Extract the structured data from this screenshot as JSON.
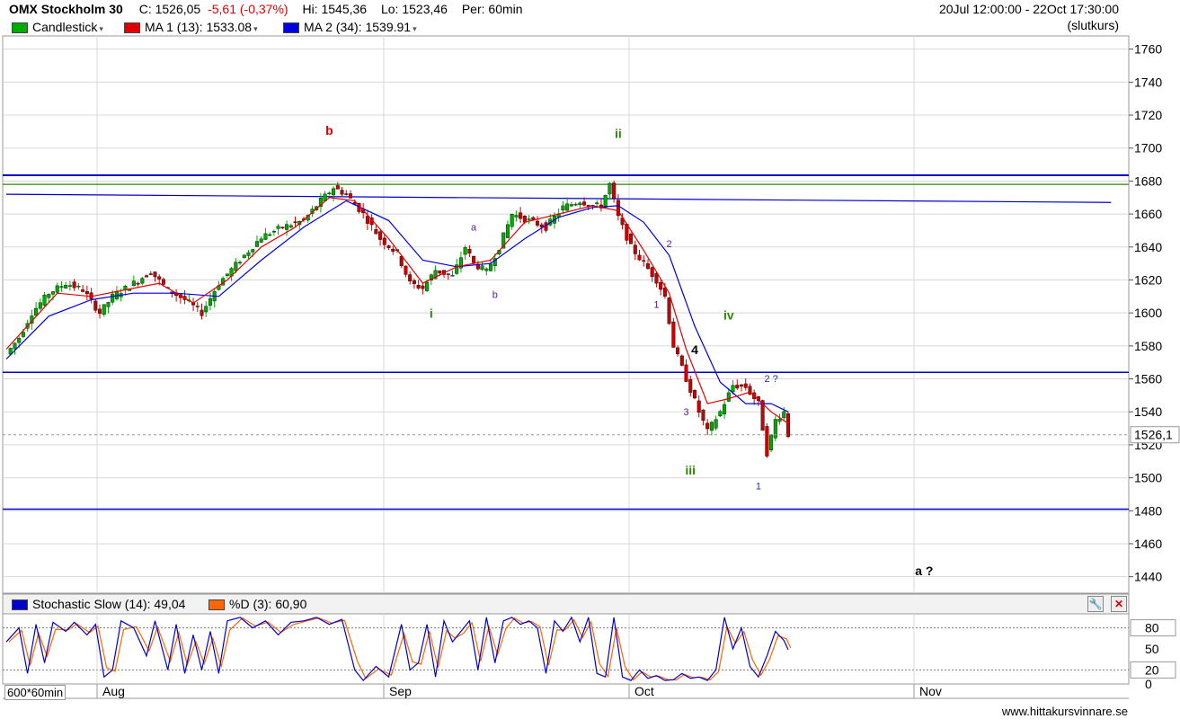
{
  "header": {
    "title": "OMX Stockholm 30",
    "close_label": "C:",
    "close_value": "1526,05",
    "change": "-5,61 (-0,37%)",
    "hi_label": "Hi:",
    "hi_value": "1545,36",
    "lo_label": "Lo:",
    "lo_value": "1523,46",
    "period_label": "Per:",
    "period_value": "60min",
    "date_range": "20Jul 12:00:00 - 22Oct 17:30:00",
    "price_note": "(slutkurs)"
  },
  "legend": {
    "candlestick": "Candlestick",
    "ma1": "MA 1 (13): 1533.08",
    "ma2": "MA 2 (34): 1539.91",
    "stoch": "Stochastic Slow (14): 49,04",
    "pctd": "%D (3): 60,90"
  },
  "colors": {
    "candle_swatch": "#00aa00",
    "ma1": "#e00000",
    "ma2": "#0000e0",
    "stoch": "#0000cc",
    "pctd": "#ff6600",
    "bull": "#00aa00",
    "bear": "#cc0000",
    "wave_red": "#dd0000",
    "wave_green": "#2a8a00",
    "wave_purple": "#551a8b",
    "wave_blue": "#2233aa"
  },
  "footer": {
    "interval_label": "600*60min",
    "website": "www.hittakursvinnare.se"
  },
  "chart_data": [
    {
      "type": "candlestick",
      "title": "OMX Stockholm 30",
      "x_tick_labels": [
        "Aug",
        "Sep",
        "Oct",
        "Nov"
      ],
      "y_ticks": [
        1440,
        1460,
        1480,
        1500,
        1520,
        1540,
        1560,
        1580,
        1600,
        1620,
        1640,
        1660,
        1680,
        1700,
        1720,
        1740,
        1760
      ],
      "ylim": [
        1430,
        1768
      ],
      "last_price_label": "1526,1",
      "last_price": 1526.1,
      "grid": true,
      "close_path": [
        [
          0,
          1575
        ],
        [
          3,
          1585
        ],
        [
          6,
          1600
        ],
        [
          10,
          1612
        ],
        [
          14,
          1618
        ],
        [
          18,
          1614
        ],
        [
          22,
          1600
        ],
        [
          25,
          1610
        ],
        [
          30,
          1618
        ],
        [
          34,
          1625
        ],
        [
          38,
          1614
        ],
        [
          42,
          1608
        ],
        [
          46,
          1600
        ],
        [
          50,
          1618
        ],
        [
          55,
          1632
        ],
        [
          60,
          1646
        ],
        [
          65,
          1652
        ],
        [
          70,
          1656
        ],
        [
          74,
          1668
        ],
        [
          77,
          1676
        ],
        [
          80,
          1672
        ],
        [
          84,
          1660
        ],
        [
          88,
          1645
        ],
        [
          92,
          1636
        ],
        [
          95,
          1618
        ],
        [
          98,
          1615
        ],
        [
          101,
          1626
        ],
        [
          105,
          1622
        ],
        [
          108,
          1640
        ],
        [
          110,
          1630
        ],
        [
          113,
          1625
        ],
        [
          116,
          1640
        ],
        [
          119,
          1660
        ],
        [
          123,
          1656
        ],
        [
          127,
          1652
        ],
        [
          131,
          1664
        ],
        [
          135,
          1668
        ],
        [
          138,
          1665
        ],
        [
          140,
          1665
        ],
        [
          142,
          1678
        ],
        [
          144,
          1658
        ],
        [
          147,
          1640
        ],
        [
          150,
          1630
        ],
        [
          153,
          1620
        ],
        [
          155,
          1610
        ],
        [
          157,
          1580
        ],
        [
          160,
          1560
        ],
        [
          163,
          1540
        ],
        [
          165,
          1528
        ],
        [
          168,
          1540
        ],
        [
          171,
          1556
        ],
        [
          174,
          1555
        ],
        [
          177,
          1545
        ],
        [
          179,
          1515
        ],
        [
          181,
          1535
        ],
        [
          183,
          1540
        ],
        [
          184,
          1526
        ]
      ],
      "ma1_path": [
        [
          0,
          1578
        ],
        [
          6,
          1595
        ],
        [
          12,
          1612
        ],
        [
          20,
          1610
        ],
        [
          28,
          1614
        ],
        [
          36,
          1618
        ],
        [
          44,
          1606
        ],
        [
          52,
          1620
        ],
        [
          60,
          1640
        ],
        [
          68,
          1652
        ],
        [
          76,
          1670
        ],
        [
          82,
          1668
        ],
        [
          90,
          1645
        ],
        [
          98,
          1618
        ],
        [
          106,
          1628
        ],
        [
          114,
          1632
        ],
        [
          122,
          1655
        ],
        [
          130,
          1660
        ],
        [
          138,
          1665
        ],
        [
          144,
          1662
        ],
        [
          150,
          1638
        ],
        [
          156,
          1612
        ],
        [
          160,
          1578
        ],
        [
          165,
          1545
        ],
        [
          170,
          1548
        ],
        [
          175,
          1552
        ],
        [
          180,
          1540
        ],
        [
          184,
          1533
        ]
      ],
      "ma2_path": [
        [
          0,
          1572
        ],
        [
          10,
          1598
        ],
        [
          20,
          1608
        ],
        [
          30,
          1612
        ],
        [
          40,
          1612
        ],
        [
          50,
          1610
        ],
        [
          60,
          1632
        ],
        [
          70,
          1652
        ],
        [
          80,
          1668
        ],
        [
          90,
          1656
        ],
        [
          98,
          1632
        ],
        [
          106,
          1628
        ],
        [
          114,
          1630
        ],
        [
          122,
          1645
        ],
        [
          130,
          1658
        ],
        [
          138,
          1664
        ],
        [
          144,
          1665
        ],
        [
          150,
          1655
        ],
        [
          156,
          1635
        ],
        [
          162,
          1592
        ],
        [
          168,
          1558
        ],
        [
          174,
          1545
        ],
        [
          180,
          1545
        ],
        [
          184,
          1540
        ]
      ],
      "horizontal_lines": [
        {
          "price": 1683.5,
          "color": "#0000cc",
          "width": 2
        },
        {
          "price": 1678,
          "color": "#2a8a00",
          "width": 1.2
        },
        {
          "price": 1564,
          "color": "#0000cc",
          "width": 1.5
        },
        {
          "price": 1481,
          "color": "#0000cc",
          "width": 1.5
        }
      ],
      "trendline": {
        "from": [
          0,
          1672
        ],
        "to": [
          260,
          1667
        ],
        "color": "#0000cc"
      },
      "wave_labels": [
        {
          "text": "b",
          "bar": 76,
          "price": 1708,
          "color": "red"
        },
        {
          "text": "ii",
          "bar": 144,
          "price": 1706,
          "color": "green"
        },
        {
          "text": "a",
          "bar": 110,
          "price": 1650,
          "color": "purple"
        },
        {
          "text": "b",
          "bar": 115,
          "price": 1609,
          "color": "purple"
        },
        {
          "text": "i",
          "bar": 100,
          "price": 1597,
          "color": "green"
        },
        {
          "text": "2",
          "bar": 156,
          "price": 1640,
          "color": "purple"
        },
        {
          "text": "1",
          "bar": 153,
          "price": 1603,
          "color": "purple"
        },
        {
          "text": "iv",
          "bar": 170,
          "price": 1596,
          "color": "green"
        },
        {
          "text": "4",
          "bar": 162,
          "price": 1575,
          "color": "black"
        },
        {
          "text": "3",
          "bar": 160,
          "price": 1538,
          "color": "purple"
        },
        {
          "text": "2 ?",
          "bar": 180,
          "price": 1558,
          "color": "blue"
        },
        {
          "text": "iii",
          "bar": 161,
          "price": 1502,
          "color": "green"
        },
        {
          "text": "1",
          "bar": 177,
          "price": 1493,
          "color": "blue"
        },
        {
          "text": "a ?",
          "bar": 216,
          "price": 1441,
          "color": "black"
        }
      ]
    },
    {
      "type": "line",
      "title": "Stochastic Slow (14)",
      "ylim": [
        0,
        100
      ],
      "y_tick_labels": [
        "0",
        "20",
        "50",
        "80"
      ],
      "y_ticks": [
        0,
        20,
        50,
        80
      ],
      "series": [
        {
          "name": "Stochastic Slow (14)",
          "last": 49.04
        },
        {
          "name": "%D (3)",
          "last": 60.9
        }
      ],
      "stoch_path": [
        [
          0,
          60
        ],
        [
          3,
          80
        ],
        [
          5,
          15
        ],
        [
          7,
          85
        ],
        [
          9,
          30
        ],
        [
          11,
          88
        ],
        [
          14,
          75
        ],
        [
          16,
          88
        ],
        [
          19,
          70
        ],
        [
          21,
          85
        ],
        [
          23,
          10
        ],
        [
          25,
          20
        ],
        [
          27,
          90
        ],
        [
          30,
          80
        ],
        [
          33,
          40
        ],
        [
          35,
          90
        ],
        [
          38,
          20
        ],
        [
          40,
          85
        ],
        [
          42,
          15
        ],
        [
          44,
          70
        ],
        [
          46,
          20
        ],
        [
          48,
          75
        ],
        [
          50,
          15
        ],
        [
          52,
          90
        ],
        [
          55,
          95
        ],
        [
          58,
          80
        ],
        [
          61,
          90
        ],
        [
          64,
          70
        ],
        [
          67,
          88
        ],
        [
          70,
          90
        ],
        [
          73,
          95
        ],
        [
          76,
          85
        ],
        [
          79,
          92
        ],
        [
          82,
          20
        ],
        [
          84,
          5
        ],
        [
          87,
          25
        ],
        [
          90,
          10
        ],
        [
          93,
          85
        ],
        [
          95,
          20
        ],
        [
          97,
          30
        ],
        [
          99,
          85
        ],
        [
          101,
          10
        ],
        [
          103,
          90
        ],
        [
          105,
          60
        ],
        [
          107,
          75
        ],
        [
          109,
          90
        ],
        [
          111,
          20
        ],
        [
          113,
          95
        ],
        [
          115,
          30
        ],
        [
          117,
          90
        ],
        [
          119,
          95
        ],
        [
          121,
          85
        ],
        [
          123,
          90
        ],
        [
          125,
          80
        ],
        [
          127,
          15
        ],
        [
          129,
          90
        ],
        [
          131,
          75
        ],
        [
          133,
          95
        ],
        [
          135,
          60
        ],
        [
          137,
          95
        ],
        [
          139,
          15
        ],
        [
          141,
          10
        ],
        [
          143,
          95
        ],
        [
          145,
          10
        ],
        [
          147,
          5
        ],
        [
          149,
          20
        ],
        [
          151,
          8
        ],
        [
          153,
          12
        ],
        [
          155,
          5
        ],
        [
          157,
          6
        ],
        [
          159,
          15
        ],
        [
          161,
          8
        ],
        [
          163,
          10
        ],
        [
          165,
          5
        ],
        [
          167,
          20
        ],
        [
          169,
          95
        ],
        [
          171,
          50
        ],
        [
          173,
          80
        ],
        [
          175,
          25
        ],
        [
          177,
          10
        ],
        [
          179,
          40
        ],
        [
          181,
          75
        ],
        [
          183,
          62
        ],
        [
          184,
          49
        ]
      ]
    }
  ]
}
